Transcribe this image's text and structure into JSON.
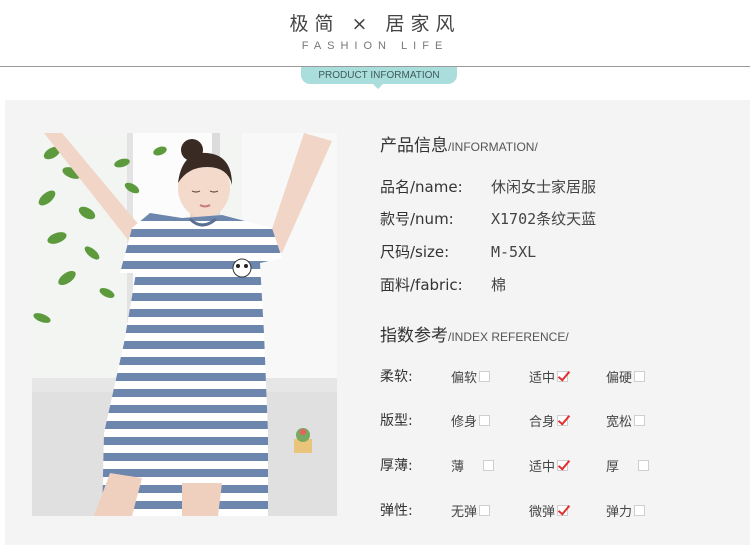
{
  "header": {
    "title": "极简 × 居家风",
    "subtitle": "FASHION LIFE",
    "tab_label": "PRODUCT INFORMATION"
  },
  "product_info": {
    "heading_cn": "产品信息",
    "heading_en": "/INFORMATION/",
    "rows": [
      {
        "key": "品名/name:",
        "value": "休闲女士家居服"
      },
      {
        "key": "款号/num:",
        "value": "X1702条纹天蓝"
      },
      {
        "key": "尺码/size:",
        "value": "M-5XL"
      },
      {
        "key": "面料/fabric:",
        "value": "棉"
      }
    ]
  },
  "index_reference": {
    "heading_cn": "指数参考",
    "heading_en": "/INDEX REFERENCE/",
    "rows": [
      {
        "label": "柔软:",
        "options": [
          {
            "text": "偏软",
            "checked": false
          },
          {
            "text": "适中",
            "checked": true
          },
          {
            "text": "偏硬",
            "checked": false
          }
        ]
      },
      {
        "label": "版型:",
        "options": [
          {
            "text": "修身",
            "checked": false
          },
          {
            "text": "合身",
            "checked": true
          },
          {
            "text": "宽松",
            "checked": false
          }
        ]
      },
      {
        "label": "厚薄:",
        "options": [
          {
            "text": "薄",
            "checked": false
          },
          {
            "text": "适中",
            "checked": true
          },
          {
            "text": "厚",
            "checked": false
          }
        ]
      },
      {
        "label": "弹性:",
        "options": [
          {
            "text": "无弹",
            "checked": false
          },
          {
            "text": "微弹",
            "checked": true
          },
          {
            "text": "弹力",
            "checked": false
          }
        ]
      }
    ]
  },
  "colors": {
    "tab": "#a9dedd",
    "stripe_blue": "#6d86ad",
    "check": "#e03030"
  }
}
